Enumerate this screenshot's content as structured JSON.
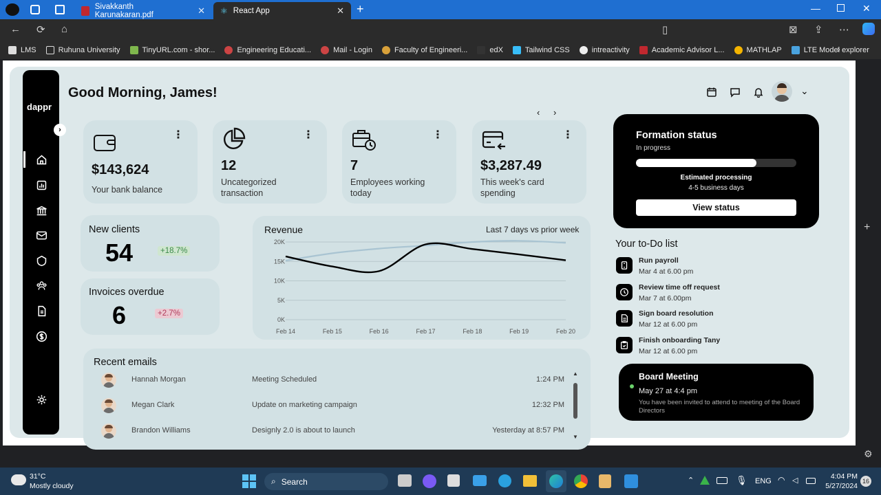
{
  "browser": {
    "tabs": [
      {
        "label": "Sivakkanth Karunakaran.pdf",
        "active": false
      },
      {
        "label": "React App",
        "active": true
      }
    ],
    "bookmarks": [
      "LMS",
      "Ruhuna University",
      "TinyURL.com - shor...",
      "Engineering Educati...",
      "Mail - Login",
      "Faculty of Engineeri...",
      "edX",
      "Tailwind CSS",
      "intreactivity",
      "Academic Advisor L...",
      "MATHLAP",
      "LTE Model explorer"
    ]
  },
  "app": {
    "logo": "dappr",
    "greeting": "Good Morning,  James!"
  },
  "stats": [
    {
      "value": "$143,624",
      "label": "Your bank balance",
      "icon": "wallet-icon"
    },
    {
      "value": "12",
      "label": "Uncategorized transaction",
      "icon": "pie-chart-icon"
    },
    {
      "value": "7",
      "label": "Employees working today",
      "icon": "briefcase-clock-icon"
    },
    {
      "value": "$3,287.49",
      "label": "This week's card spending",
      "icon": "card-return-icon"
    }
  ],
  "new_clients": {
    "title": "New clients",
    "value": "54",
    "change": "+18.7%",
    "change_color": "#3c8a4a"
  },
  "invoices": {
    "title": "Invoices overdue",
    "value": "6",
    "change": "+2.7%",
    "change_color": "#b03a5a"
  },
  "revenue": {
    "title": "Revenue",
    "period": "Last 7 days vs prior week"
  },
  "chart_data": {
    "type": "line",
    "title": "Revenue",
    "subtitle": "Last 7 days vs prior week",
    "x": [
      "Feb 14",
      "Feb 15",
      "Feb 16",
      "Feb 17",
      "Feb 18",
      "Feb 19",
      "Feb 20"
    ],
    "yticks": [
      "20K",
      "15K",
      "10K",
      "5K",
      "0K"
    ],
    "ylim": [
      0,
      20000
    ],
    "grid": true,
    "series": [
      {
        "values": [
          16300,
          13700,
          12500,
          19400,
          18200,
          16800,
          15300
        ],
        "color": "#000000"
      },
      {
        "values": [
          15200,
          17100,
          18300,
          19100,
          20000,
          20300,
          19800
        ],
        "color": "#a9c4d2"
      }
    ]
  },
  "emails": {
    "title": "Recent emails",
    "rows": [
      {
        "name": "Hannah Morgan",
        "subject": "Meeting Scheduled",
        "time": "1:24 PM"
      },
      {
        "name": "Megan Clark",
        "subject": "Update on marketing campaign",
        "time": "12:32 PM"
      },
      {
        "name": "Brandon Williams",
        "subject": "Designly 2.0 is about to launch",
        "time": "Yesterday at 8:57 PM"
      }
    ]
  },
  "formation": {
    "title": "Formation status",
    "status": "In progress",
    "progress": 0.75,
    "estimate_title": "Estimated processing",
    "estimate": "4-5 business days",
    "button": "View status"
  },
  "todo": {
    "title": "Your to-Do list",
    "items": [
      {
        "title": "Run payroll",
        "date": "Mar 4 at 6.00 pm",
        "icon": "payroll-icon"
      },
      {
        "title": "Review time off request",
        "date": "Mar 7 at 6.00pm",
        "icon": "clock-icon"
      },
      {
        "title": "Sign board resolution",
        "date": "Mar 12 at 6.00 pm",
        "icon": "document-icon"
      },
      {
        "title": "Finish onboarding Tany",
        "date": "Mar 12 at 6.00 pm",
        "icon": "clipboard-icon"
      }
    ]
  },
  "meeting": {
    "title": "Board Meeting",
    "time": "May 27 at 4:4 pm",
    "desc": "You have been invited to attend to meeting of the Board Directors"
  },
  "taskbar": {
    "weather_temp": "31°C",
    "weather_desc": "Mostly cloudy",
    "search": "Search",
    "lang": "ENG",
    "time": "4:04 PM",
    "date": "5/27/2024",
    "badge": "16"
  }
}
